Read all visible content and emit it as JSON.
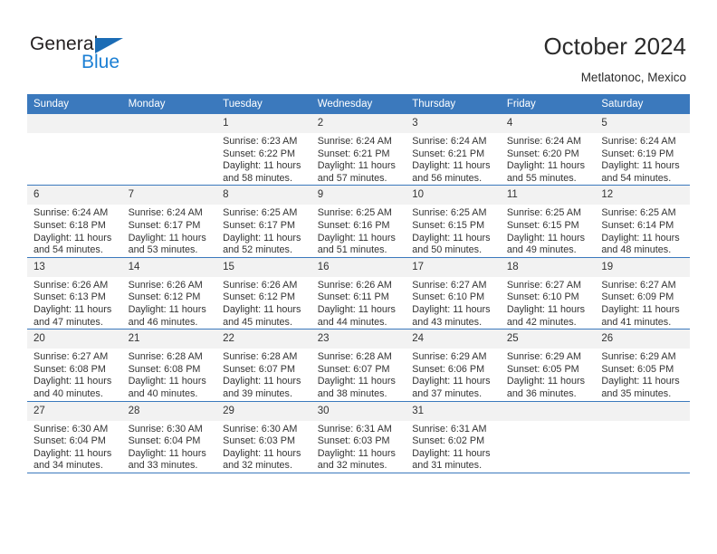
{
  "brand": {
    "name_part1": "General",
    "name_part2": "Blue",
    "triangle_color": "#1b6cb5",
    "blue_color": "#1b7fd4"
  },
  "header": {
    "title": "October 2024",
    "subtitle": "Metlatonoc, Mexico",
    "header_bg": "#3b79bd",
    "daynum_bg": "#f2f2f2"
  },
  "weekdays": [
    "Sunday",
    "Monday",
    "Tuesday",
    "Wednesday",
    "Thursday",
    "Friday",
    "Saturday"
  ],
  "labels": {
    "sunrise_prefix": "Sunrise: ",
    "sunset_prefix": "Sunset: ",
    "daylight_prefix": "Daylight: "
  },
  "weeks": [
    [
      {
        "day": "",
        "empty": true
      },
      {
        "day": "",
        "empty": true
      },
      {
        "day": "1",
        "sunrise": "Sunrise: 6:23 AM",
        "sunset": "Sunset: 6:22 PM",
        "daylight_1": "Daylight: 11 hours",
        "daylight_2": "and 58 minutes."
      },
      {
        "day": "2",
        "sunrise": "Sunrise: 6:24 AM",
        "sunset": "Sunset: 6:21 PM",
        "daylight_1": "Daylight: 11 hours",
        "daylight_2": "and 57 minutes."
      },
      {
        "day": "3",
        "sunrise": "Sunrise: 6:24 AM",
        "sunset": "Sunset: 6:21 PM",
        "daylight_1": "Daylight: 11 hours",
        "daylight_2": "and 56 minutes."
      },
      {
        "day": "4",
        "sunrise": "Sunrise: 6:24 AM",
        "sunset": "Sunset: 6:20 PM",
        "daylight_1": "Daylight: 11 hours",
        "daylight_2": "and 55 minutes."
      },
      {
        "day": "5",
        "sunrise": "Sunrise: 6:24 AM",
        "sunset": "Sunset: 6:19 PM",
        "daylight_1": "Daylight: 11 hours",
        "daylight_2": "and 54 minutes."
      }
    ],
    [
      {
        "day": "6",
        "sunrise": "Sunrise: 6:24 AM",
        "sunset": "Sunset: 6:18 PM",
        "daylight_1": "Daylight: 11 hours",
        "daylight_2": "and 54 minutes."
      },
      {
        "day": "7",
        "sunrise": "Sunrise: 6:24 AM",
        "sunset": "Sunset: 6:17 PM",
        "daylight_1": "Daylight: 11 hours",
        "daylight_2": "and 53 minutes."
      },
      {
        "day": "8",
        "sunrise": "Sunrise: 6:25 AM",
        "sunset": "Sunset: 6:17 PM",
        "daylight_1": "Daylight: 11 hours",
        "daylight_2": "and 52 minutes."
      },
      {
        "day": "9",
        "sunrise": "Sunrise: 6:25 AM",
        "sunset": "Sunset: 6:16 PM",
        "daylight_1": "Daylight: 11 hours",
        "daylight_2": "and 51 minutes."
      },
      {
        "day": "10",
        "sunrise": "Sunrise: 6:25 AM",
        "sunset": "Sunset: 6:15 PM",
        "daylight_1": "Daylight: 11 hours",
        "daylight_2": "and 50 minutes."
      },
      {
        "day": "11",
        "sunrise": "Sunrise: 6:25 AM",
        "sunset": "Sunset: 6:15 PM",
        "daylight_1": "Daylight: 11 hours",
        "daylight_2": "and 49 minutes."
      },
      {
        "day": "12",
        "sunrise": "Sunrise: 6:25 AM",
        "sunset": "Sunset: 6:14 PM",
        "daylight_1": "Daylight: 11 hours",
        "daylight_2": "and 48 minutes."
      }
    ],
    [
      {
        "day": "13",
        "sunrise": "Sunrise: 6:26 AM",
        "sunset": "Sunset: 6:13 PM",
        "daylight_1": "Daylight: 11 hours",
        "daylight_2": "and 47 minutes."
      },
      {
        "day": "14",
        "sunrise": "Sunrise: 6:26 AM",
        "sunset": "Sunset: 6:12 PM",
        "daylight_1": "Daylight: 11 hours",
        "daylight_2": "and 46 minutes."
      },
      {
        "day": "15",
        "sunrise": "Sunrise: 6:26 AM",
        "sunset": "Sunset: 6:12 PM",
        "daylight_1": "Daylight: 11 hours",
        "daylight_2": "and 45 minutes."
      },
      {
        "day": "16",
        "sunrise": "Sunrise: 6:26 AM",
        "sunset": "Sunset: 6:11 PM",
        "daylight_1": "Daylight: 11 hours",
        "daylight_2": "and 44 minutes."
      },
      {
        "day": "17",
        "sunrise": "Sunrise: 6:27 AM",
        "sunset": "Sunset: 6:10 PM",
        "daylight_1": "Daylight: 11 hours",
        "daylight_2": "and 43 minutes."
      },
      {
        "day": "18",
        "sunrise": "Sunrise: 6:27 AM",
        "sunset": "Sunset: 6:10 PM",
        "daylight_1": "Daylight: 11 hours",
        "daylight_2": "and 42 minutes."
      },
      {
        "day": "19",
        "sunrise": "Sunrise: 6:27 AM",
        "sunset": "Sunset: 6:09 PM",
        "daylight_1": "Daylight: 11 hours",
        "daylight_2": "and 41 minutes."
      }
    ],
    [
      {
        "day": "20",
        "sunrise": "Sunrise: 6:27 AM",
        "sunset": "Sunset: 6:08 PM",
        "daylight_1": "Daylight: 11 hours",
        "daylight_2": "and 40 minutes."
      },
      {
        "day": "21",
        "sunrise": "Sunrise: 6:28 AM",
        "sunset": "Sunset: 6:08 PM",
        "daylight_1": "Daylight: 11 hours",
        "daylight_2": "and 40 minutes."
      },
      {
        "day": "22",
        "sunrise": "Sunrise: 6:28 AM",
        "sunset": "Sunset: 6:07 PM",
        "daylight_1": "Daylight: 11 hours",
        "daylight_2": "and 39 minutes."
      },
      {
        "day": "23",
        "sunrise": "Sunrise: 6:28 AM",
        "sunset": "Sunset: 6:07 PM",
        "daylight_1": "Daylight: 11 hours",
        "daylight_2": "and 38 minutes."
      },
      {
        "day": "24",
        "sunrise": "Sunrise: 6:29 AM",
        "sunset": "Sunset: 6:06 PM",
        "daylight_1": "Daylight: 11 hours",
        "daylight_2": "and 37 minutes."
      },
      {
        "day": "25",
        "sunrise": "Sunrise: 6:29 AM",
        "sunset": "Sunset: 6:05 PM",
        "daylight_1": "Daylight: 11 hours",
        "daylight_2": "and 36 minutes."
      },
      {
        "day": "26",
        "sunrise": "Sunrise: 6:29 AM",
        "sunset": "Sunset: 6:05 PM",
        "daylight_1": "Daylight: 11 hours",
        "daylight_2": "and 35 minutes."
      }
    ],
    [
      {
        "day": "27",
        "sunrise": "Sunrise: 6:30 AM",
        "sunset": "Sunset: 6:04 PM",
        "daylight_1": "Daylight: 11 hours",
        "daylight_2": "and 34 minutes."
      },
      {
        "day": "28",
        "sunrise": "Sunrise: 6:30 AM",
        "sunset": "Sunset: 6:04 PM",
        "daylight_1": "Daylight: 11 hours",
        "daylight_2": "and 33 minutes."
      },
      {
        "day": "29",
        "sunrise": "Sunrise: 6:30 AM",
        "sunset": "Sunset: 6:03 PM",
        "daylight_1": "Daylight: 11 hours",
        "daylight_2": "and 32 minutes."
      },
      {
        "day": "30",
        "sunrise": "Sunrise: 6:31 AM",
        "sunset": "Sunset: 6:03 PM",
        "daylight_1": "Daylight: 11 hours",
        "daylight_2": "and 32 minutes."
      },
      {
        "day": "31",
        "sunrise": "Sunrise: 6:31 AM",
        "sunset": "Sunset: 6:02 PM",
        "daylight_1": "Daylight: 11 hours",
        "daylight_2": "and 31 minutes."
      },
      {
        "day": "",
        "empty": true
      },
      {
        "day": "",
        "empty": true
      }
    ]
  ]
}
